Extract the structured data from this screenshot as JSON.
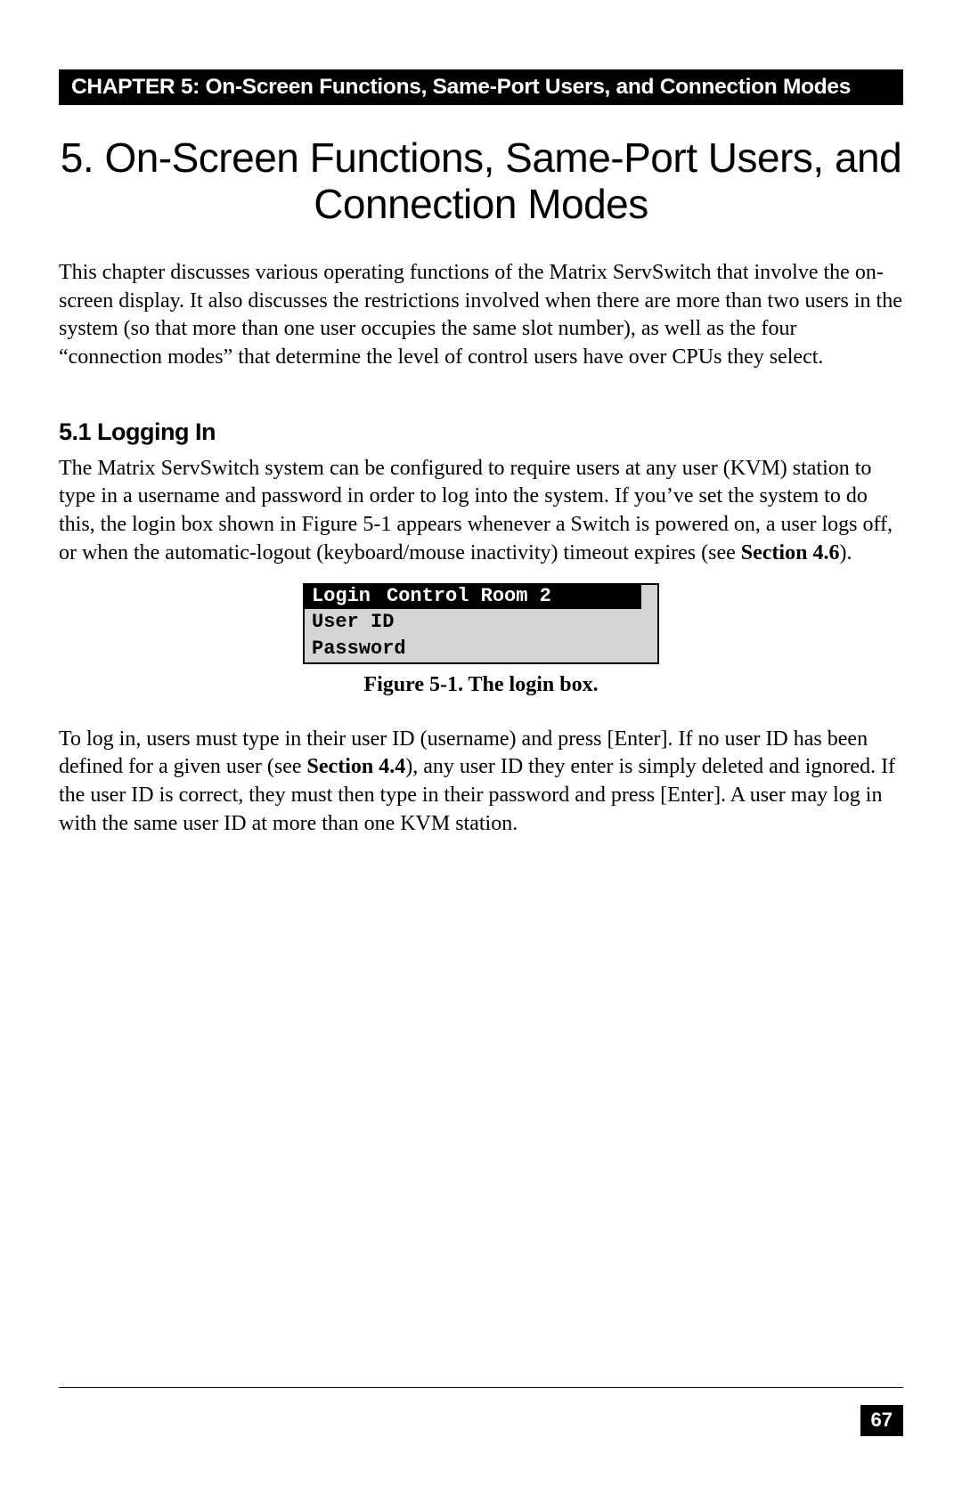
{
  "header": {
    "chapter_bar": "CHAPTER 5: On-Screen Functions, Same-Port Users, and Connection Modes"
  },
  "title": "5. On-Screen Functions, Same-Port Users, and Connection Modes",
  "intro": "This chapter discusses various operating functions of the Matrix ServSwitch that involve the on-screen display. It also discusses the restrictions involved when there are more than two users in the system (so that more than one user occupies the same slot number), as well as the four “connection modes” that determine the level of control users have over CPUs they select.",
  "section": {
    "heading": "5.1 Logging In",
    "para1_a": "The Matrix ServSwitch system can be configured to require users at any user (KVM) station to type in a username and password in order to log into the system. If you’ve set the system to do this, the login box shown in Figure 5-1 appears whenever a Switch is powered on, a user logs off, or when the automatic-logout (keyboard/mouse inactivity) timeout expires (see ",
    "para1_ref": "Section 4.6",
    "para1_b": ")."
  },
  "login_box": {
    "title_left": "Login",
    "title_right": "Control Room 2",
    "row1": "User ID",
    "row2": "Password"
  },
  "figure_caption": "Figure 5-1. The login box.",
  "para2": {
    "a": "To log in, users must type in their user ID (username) and press [Enter]. If no user ID has been defined for a given user (see ",
    "ref": "Section 4.4",
    "b": "), any user ID they enter is simply deleted and ignored. If the user ID is correct, they must then type in their password and press [Enter]. A user may log in with the same user ID at more than one KVM station."
  },
  "page_number": "67"
}
